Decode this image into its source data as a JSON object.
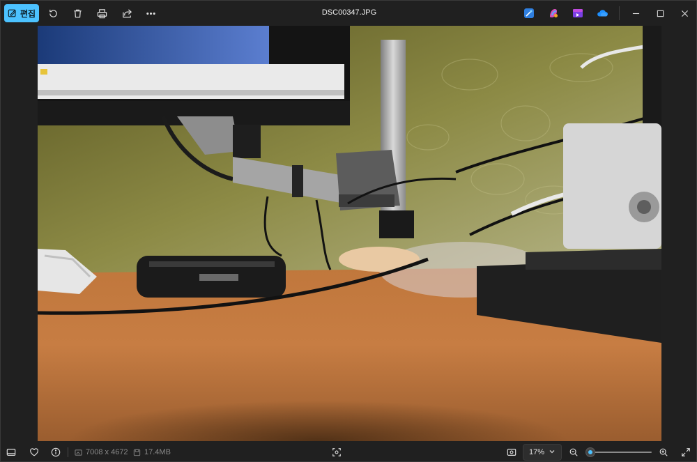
{
  "titlebar": {
    "edit_label": "편집",
    "file_name": "DSC00347.JPG",
    "icons": [
      "edit-photo-icon",
      "rotate-icon",
      "delete-icon",
      "print-icon",
      "share-icon",
      "more-icon"
    ],
    "apps": [
      "designer-icon",
      "copilot-icon",
      "clipchamp-icon",
      "onedrive-icon"
    ]
  },
  "statusbar": {
    "dimensions": "7008 x 4672",
    "file_size": "17.4MB",
    "zoom_level": "17%",
    "zoom_slider_fraction": 0.0
  },
  "colors": {
    "accent": "#4cc2ff",
    "background": "#202020",
    "muted_text": "#8a8a8a"
  }
}
